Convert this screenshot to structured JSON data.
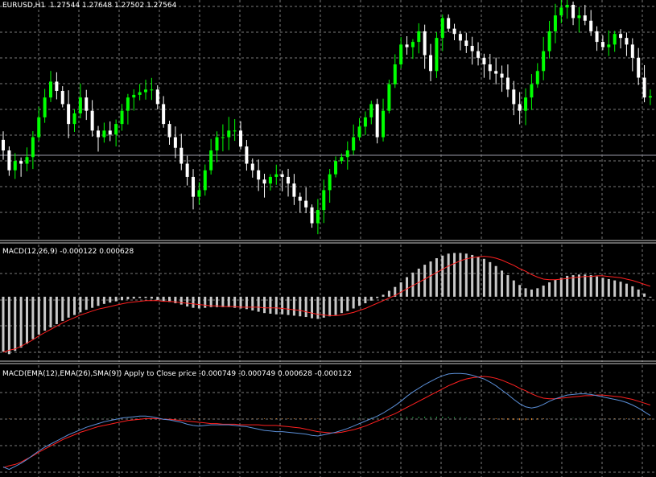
{
  "main_pane": {
    "symbol_timeframe": "EURUSD,H1",
    "ohlc": "1.27544 1.27648 1.27502 1.27564"
  },
  "macd_pane": {
    "title": "MACD(12,26,9) -0.000122 0.000628"
  },
  "custom_macd_pane": {
    "title": "MACD(EMA(12),EMA(26),SMA(9)) Apply to Close price -0.000749 -0.000749 0.000628 -0.000122"
  },
  "colors": {
    "background": "#000000",
    "grid": "#7a7a7a",
    "bull": "#00ff00",
    "bear": "#ffffff",
    "histogram": "#c8c8c8",
    "signal": "#ff2020",
    "macd_line": "#5b8fd8",
    "hist_up": "#26a84a",
    "hist_down": "#ff9020",
    "separator": "#c8c8c8"
  },
  "chart_data": [
    {
      "type": "candlestick",
      "bar_count": 110,
      "y_range": [
        1.2695,
        1.287
      ],
      "current_price": 1.27564,
      "closes": [
        1.276,
        1.2745,
        1.2752,
        1.275,
        1.2755,
        1.277,
        1.2785,
        1.28,
        1.2812,
        1.2805,
        1.2795,
        1.278,
        1.2788,
        1.28,
        1.279,
        1.2775,
        1.277,
        1.2775,
        1.2772,
        1.278,
        1.279,
        1.28,
        1.2802,
        1.2804,
        1.2806,
        1.2806,
        1.2795,
        1.278,
        1.277,
        1.2762,
        1.275,
        1.274,
        1.2725,
        1.273,
        1.2745,
        1.276,
        1.277,
        1.277,
        1.2775,
        1.2775,
        1.2763,
        1.275,
        1.2745,
        1.2738,
        1.2735,
        1.274,
        1.2742,
        1.274,
        1.2735,
        1.2725,
        1.2722,
        1.2717,
        1.2705,
        1.2715,
        1.273,
        1.2742,
        1.2752,
        1.2755,
        1.276,
        1.277,
        1.2778,
        1.2785,
        1.2795,
        1.277,
        1.279,
        1.281,
        1.2825,
        1.284,
        1.2838,
        1.2842,
        1.285,
        1.2832,
        1.282,
        1.2845,
        1.286,
        1.2852,
        1.2848,
        1.2843,
        1.2839,
        1.2835,
        1.283,
        1.2825,
        1.282,
        1.2818,
        1.2815,
        1.2806,
        1.2795,
        1.279,
        1.28,
        1.281,
        1.282,
        1.2835,
        1.285,
        1.2862,
        1.2868,
        1.287,
        1.286,
        1.2862,
        1.2858,
        1.285,
        1.2842,
        1.2838,
        1.284,
        1.2848,
        1.2845,
        1.284,
        1.283,
        1.2815,
        1.28,
        1.2801
      ]
    },
    {
      "type": "bar",
      "name": "MACD(12,26,9)",
      "macd_values": [
        -0.00084,
        -0.00088,
        -0.00083,
        -0.00078,
        -0.00072,
        -0.00065,
        -0.00058,
        -0.00052,
        -0.00047,
        -0.00042,
        -0.00037,
        -0.00032,
        -0.00028,
        -0.00024,
        -0.0002,
        -0.00017,
        -0.00014,
        -0.00011,
        -9e-05,
        -7e-05,
        -5e-05,
        -4e-05,
        -3e-05,
        -2e-05,
        -2e-05,
        -3e-05,
        -5e-05,
        -7e-05,
        -8e-05,
        -0.0001,
        -0.00012,
        -0.00015,
        -0.00017,
        -0.00018,
        -0.00017,
        -0.00016,
        -0.00016,
        -0.00016,
        -0.00016,
        -0.00017,
        -0.00018,
        -0.00019,
        -0.00021,
        -0.00023,
        -0.00025,
        -0.00026,
        -0.00027,
        -0.00027,
        -0.00028,
        -0.00029,
        -0.0003,
        -0.00031,
        -0.00033,
        -0.00034,
        -0.00032,
        -0.0003,
        -0.00028,
        -0.00025,
        -0.00022,
        -0.00018,
        -0.00014,
        -0.0001,
        -6e-05,
        -2e-05,
        3e-05,
        9e-05,
        0.00015,
        0.00022,
        0.0003,
        0.00037,
        0.00043,
        0.00049,
        0.00054,
        0.00059,
        0.00063,
        0.00066,
        0.00067,
        0.00067,
        0.00066,
        0.00064,
        0.00061,
        0.00058,
        0.00053,
        0.00047,
        0.0004,
        0.00033,
        0.00025,
        0.00018,
        0.00013,
        0.00011,
        0.00013,
        0.00017,
        0.00022,
        0.00026,
        0.00029,
        0.00032,
        0.00033,
        0.00034,
        0.00034,
        0.00033,
        0.00031,
        0.00029,
        0.00027,
        0.00025,
        0.00023,
        0.0002,
        0.00016,
        0.00011,
        5e-05,
        -1e-05
      ],
      "signal_values": [
        -0.00085,
        -0.00082,
        -0.0008,
        -0.00076,
        -0.00071,
        -0.00066,
        -0.0006,
        -0.00055,
        -0.0005,
        -0.00045,
        -0.0004,
        -0.00036,
        -0.00032,
        -0.00028,
        -0.00025,
        -0.00022,
        -0.00019,
        -0.00017,
        -0.00015,
        -0.00013,
        -0.00011,
        -9e-05,
        -8e-05,
        -7e-05,
        -6e-05,
        -6e-05,
        -6e-05,
        -7e-05,
        -7e-05,
        -8e-05,
        -9e-05,
        -0.0001,
        -0.00011,
        -0.00012,
        -0.00013,
        -0.00014,
        -0.00014,
        -0.00015,
        -0.00015,
        -0.00015,
        -0.00016,
        -0.00016,
        -0.00016,
        -0.00016,
        -0.00017,
        -0.00017,
        -0.00017,
        -0.00018,
        -0.00019,
        -0.0002,
        -0.00021,
        -0.00023,
        -0.00025,
        -0.00027,
        -0.00028,
        -0.00029,
        -0.00029,
        -0.00028,
        -0.00026,
        -0.00024,
        -0.00021,
        -0.00018,
        -0.00014,
        -0.0001,
        -6e-05,
        -2e-05,
        2e-05,
        7e-05,
        0.00012,
        0.00017,
        0.00022,
        0.00027,
        0.00032,
        0.00037,
        0.00042,
        0.00047,
        0.00051,
        0.00055,
        0.00058,
        0.0006,
        0.00061,
        0.00062,
        0.00061,
        0.00059,
        0.00056,
        0.00052,
        0.00048,
        0.00043,
        0.00039,
        0.00034,
        0.0003,
        0.00027,
        0.00026,
        0.00026,
        0.00027,
        0.00028,
        0.00029,
        0.0003,
        0.00031,
        0.00031,
        0.00032,
        0.00032,
        0.00031,
        0.0003,
        0.00029,
        0.00027,
        0.00025,
        0.00022,
        0.00019,
        0.00016
      ],
      "y_range": [
        -0.00095,
        0.00075
      ]
    },
    {
      "type": "line",
      "name": "MACD(EMA(12),EMA(26),SMA(9)) Apply to Close price",
      "series": [
        {
          "name": "macd_line",
          "values_ref": "chart_data.1.macd_values"
        },
        {
          "name": "signal_line",
          "values_ref": "chart_data.1.signal_values"
        },
        {
          "name": "histogram",
          "values_ref": "difference"
        }
      ]
    }
  ]
}
